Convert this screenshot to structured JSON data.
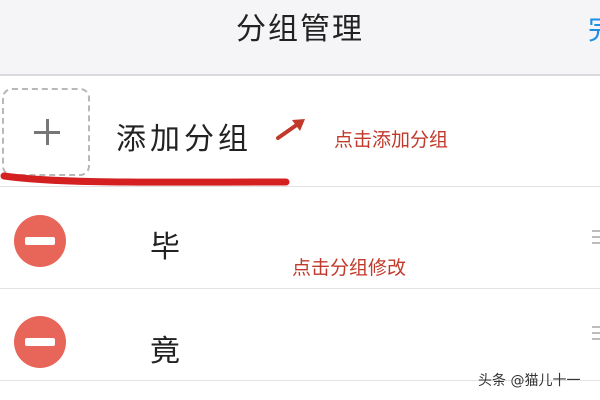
{
  "header": {
    "title": "分组管理",
    "action_label": "完"
  },
  "add_group": {
    "label": "添加分组",
    "annotation": "点击添加分组"
  },
  "groups": [
    {
      "name": "毕",
      "annotation": "点击分组修改"
    },
    {
      "name": "竟"
    }
  ],
  "watermark": "头条 @猫儿十一",
  "colors": {
    "accent": "#1a8fe3",
    "delete": "#e8655a",
    "annotation": "#c0392b"
  },
  "icons": {
    "add": "plus-icon",
    "delete": "minus-circle-icon",
    "drag": "drag-handle-icon"
  }
}
